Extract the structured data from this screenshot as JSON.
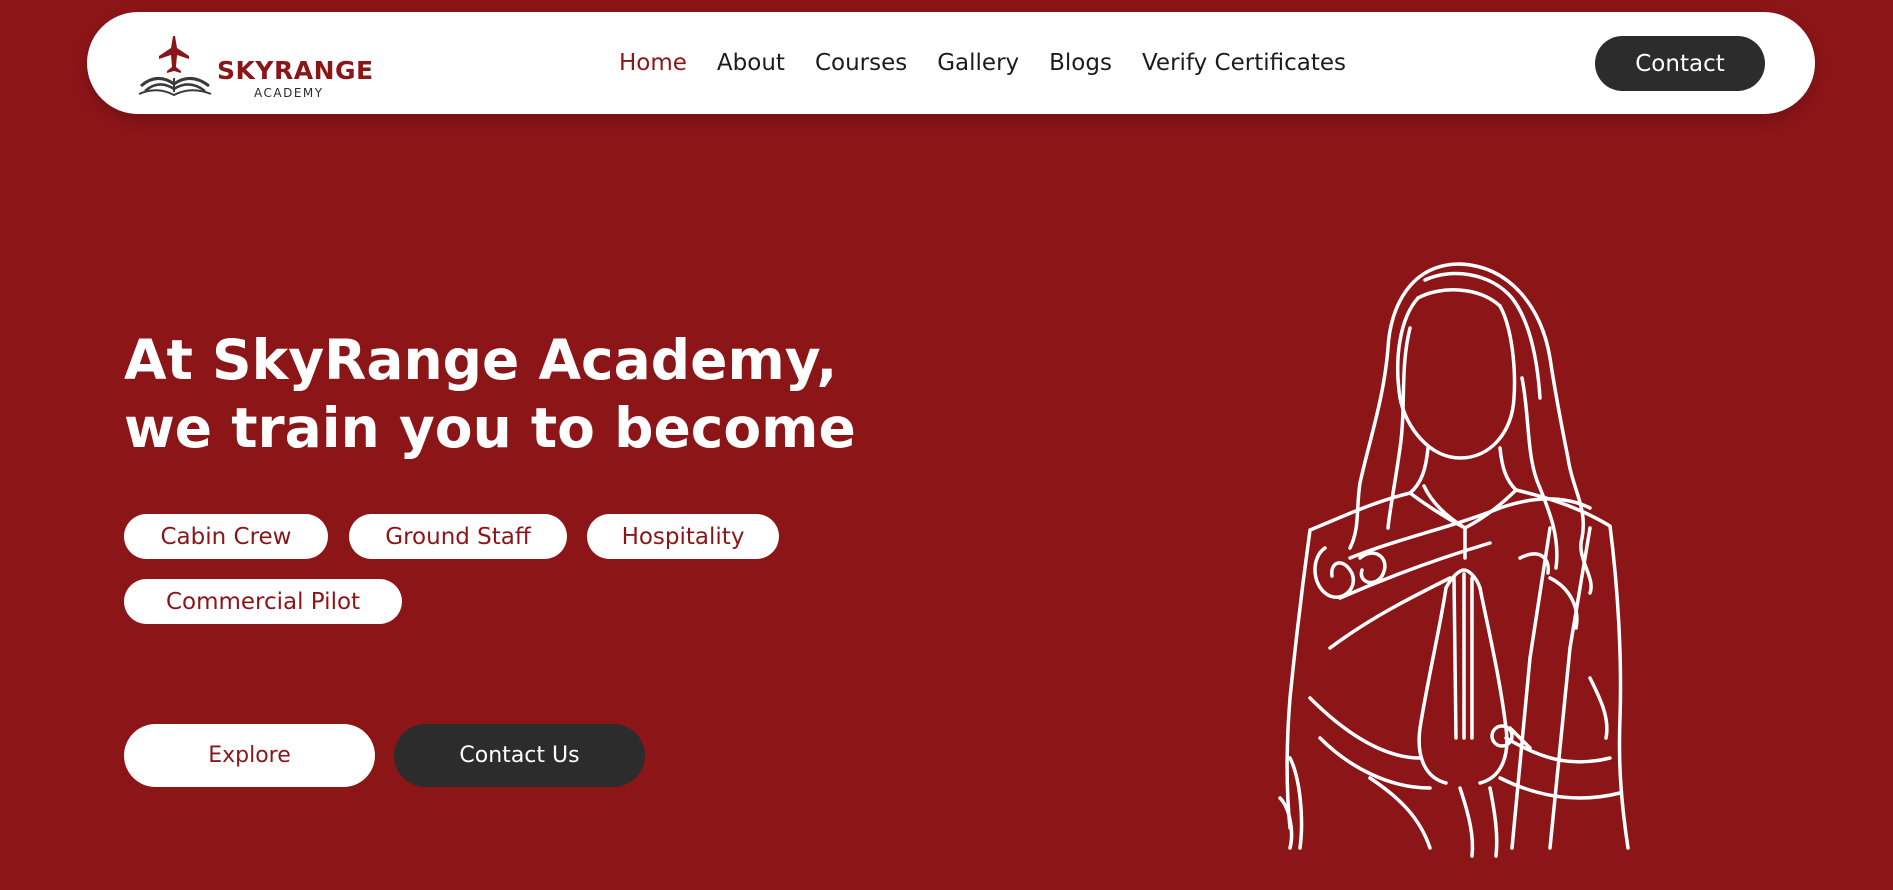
{
  "brand": {
    "name": "SKYRANGE",
    "subtitle": "ACADEMY"
  },
  "nav": {
    "items": [
      {
        "label": "Home",
        "active": true
      },
      {
        "label": "About",
        "active": false
      },
      {
        "label": "Courses",
        "active": false
      },
      {
        "label": "Gallery",
        "active": false
      },
      {
        "label": "Blogs",
        "active": false
      },
      {
        "label": "Verify Certificates",
        "active": false
      }
    ],
    "contact_label": "Contact"
  },
  "hero": {
    "title_line1": "At SkyRange Academy,",
    "title_line2": "we train you to become",
    "tags": [
      "Cabin Crew",
      "Ground Staff",
      "Hospitality",
      "Commercial Pilot"
    ],
    "explore_label": "Explore",
    "contact_us_label": "Contact Us"
  },
  "colors": {
    "brand_red": "#8c1518",
    "dark_button": "#2c2c2c",
    "white": "#ffffff"
  },
  "icons": {
    "logo": "airplane-over-open-book-logo-icon",
    "illustration": "namaste-woman-line-art-illustration"
  }
}
